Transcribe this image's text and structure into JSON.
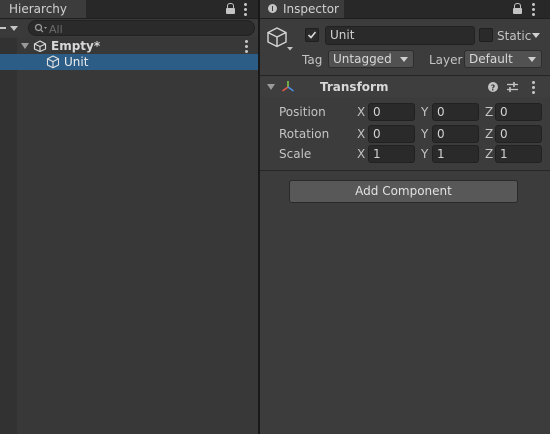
{
  "hierarchy": {
    "tab_label": "Hierarchy",
    "search_placeholder": "All",
    "scene_name": "Empty*",
    "items": [
      {
        "label": "Unit",
        "selected": true
      }
    ]
  },
  "inspector": {
    "tab_label": "Inspector",
    "object": {
      "name": "Unit",
      "active": true,
      "static_label": "Static"
    },
    "tag": {
      "label": "Tag",
      "value": "Untagged"
    },
    "layer": {
      "label": "Layer",
      "value": "Default"
    },
    "transform": {
      "title": "Transform",
      "rows": [
        {
          "label": "Position",
          "x": "0",
          "y": "0",
          "z": "0"
        },
        {
          "label": "Rotation",
          "x": "0",
          "y": "0",
          "z": "0"
        },
        {
          "label": "Scale",
          "x": "1",
          "y": "1",
          "z": "1"
        }
      ],
      "axis_labels": {
        "x": "X",
        "y": "Y",
        "z": "Z"
      }
    },
    "add_component_label": "Add Component"
  },
  "colors": {
    "selection": "#2c5d87",
    "panel_bg": "#383838",
    "tab_bar": "#282828"
  }
}
